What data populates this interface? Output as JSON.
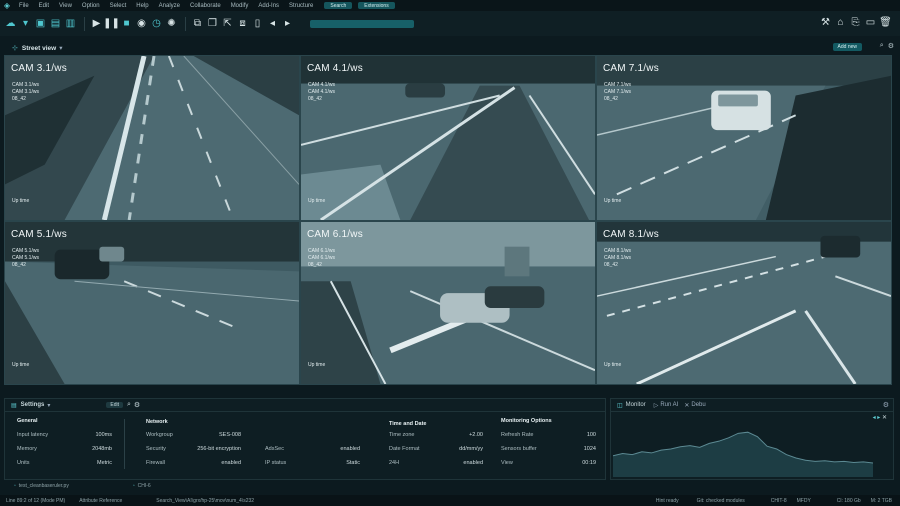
{
  "menu": {
    "items": [
      "File",
      "Edit",
      "View",
      "Option",
      "Select",
      "Help",
      "Analyze",
      "Collaborate",
      "Modify",
      "Add-Ins",
      "Structure"
    ],
    "search_label": "Search",
    "extension_label": "Extensions"
  },
  "view": {
    "title": "Street view",
    "add_label": "Add new"
  },
  "cameras": [
    {
      "title": "CAM 3.1/ws",
      "line1": "CAM 3.1/ws",
      "line2": "CAM 3.1/ws",
      "line3": "08_42",
      "uptime": "Up time"
    },
    {
      "title": "CAM 4.1/ws",
      "line1": "CAM 4.1/ws",
      "line2": "CAM 4.1/ws",
      "line3": "08_42",
      "uptime": "Up time"
    },
    {
      "title": "CAM 7.1/ws",
      "line1": "CAM 7.1/ws",
      "line2": "CAM 7.1/ws",
      "line3": "08_42",
      "uptime": "Up time"
    },
    {
      "title": "CAM 5.1/ws",
      "line1": "CAM 5.1/ws",
      "line2": "CAM 5.1/ws",
      "line3": "08_42",
      "uptime": "Up time"
    },
    {
      "title": "CAM 6.1/ws",
      "line1": "CAM 6.1/ws",
      "line2": "CAM 6.1/ws",
      "line3": "08_42",
      "uptime": "Up time"
    },
    {
      "title": "CAM 8.1/ws",
      "line1": "CAM 8.1/ws",
      "line2": "CAM 8.1/ws",
      "line3": "08_42",
      "uptime": "Up time"
    }
  ],
  "settings": {
    "title": "Settings",
    "edit_label": "Edit",
    "general": {
      "heading": "General",
      "rows": [
        {
          "label": "Input latency",
          "value": "100ms"
        },
        {
          "label": "Memory",
          "value": "2048mb"
        },
        {
          "label": "Units",
          "value": "Metric"
        }
      ]
    },
    "network": {
      "heading": "Network",
      "rows": [
        {
          "label": "Workgroup",
          "value": "SES-008"
        },
        {
          "label": "Security",
          "value": "256-bit encryption"
        },
        {
          "label": "Firewall",
          "value": "enabled"
        }
      ],
      "rows2": [
        {
          "label": "AdsSec",
          "value": "enabled"
        },
        {
          "label": "IP status",
          "value": "Static"
        }
      ]
    },
    "time": {
      "heading": "Time and Date",
      "rows": [
        {
          "label": "Time zone",
          "value": "+2.00"
        },
        {
          "label": "Date Format",
          "value": "dd/mm/yy"
        },
        {
          "label": "24H",
          "value": "enabled"
        }
      ]
    },
    "monitoring": {
      "heading": "Monitoring Options",
      "rows": [
        {
          "label": "Refresh Rate",
          "value": "100"
        },
        {
          "label": "Sensors buffer",
          "value": "1024"
        },
        {
          "label": "View",
          "value": "00:19"
        }
      ]
    }
  },
  "monitor": {
    "tab_monitor": "Monitor",
    "tab_run": "Run AI",
    "tab_debug": "Debu",
    "series": [
      0.62,
      0.58,
      0.6,
      0.55,
      0.57,
      0.52,
      0.5,
      0.46,
      0.44,
      0.47,
      0.4,
      0.36,
      0.3,
      0.22,
      0.2,
      0.28,
      0.45,
      0.5,
      0.6,
      0.66,
      0.7,
      0.72,
      0.71,
      0.73,
      0.72,
      0.74,
      0.73,
      0.75
    ]
  },
  "filebar": {
    "file": "test_cleanbaseruler.py",
    "mode": "CHI-6"
  },
  "status": {
    "position": "Line 89:2 of 12 (Mode PM)",
    "reference": "Attribute Reference",
    "path": "Search_View\\AI\\grx/hp-25\\mov\\num_4\\s232",
    "ready": "Hint ready",
    "modules": "Git: checked modules",
    "chit": "CHIT-8",
    "mfdy": "MFDY",
    "memory": "Cl: 180 Gb",
    "disk": "M: 2 TGB"
  },
  "colors": {
    "accent": "#4fc7cf",
    "panel": "#0e1e23"
  }
}
